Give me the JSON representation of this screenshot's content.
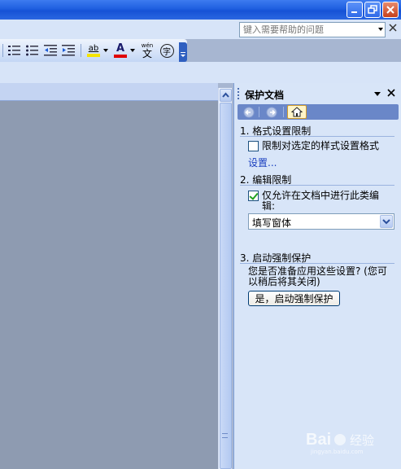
{
  "window": {
    "buttons": [
      "minimize",
      "restore",
      "close"
    ]
  },
  "help": {
    "placeholder": "键入需要帮助的问题"
  },
  "toolbar": {
    "icons": [
      "numbered-list-icon",
      "bulleted-list-icon",
      "decrease-indent-icon",
      "increase-indent-icon",
      "highlight-icon",
      "font-color-icon",
      "phonetic-guide-icon",
      "enclose-characters-icon"
    ],
    "highlight_label": "ab",
    "font_color_label": "A",
    "phonetic_label": "wén",
    "phonetic_char": "文",
    "enclose_char": "字",
    "highlight_color": "#f5e400",
    "font_color": "#e00000"
  },
  "pane": {
    "title": "保护文档",
    "section1": {
      "heading": "1. 格式设置限制",
      "checkbox_label": "限制对选定的样式设置格式",
      "checked": false,
      "link": "设置..."
    },
    "section2": {
      "heading": "2. 编辑限制",
      "checkbox_label_line1": "仅允许在文档中进行此类编",
      "checkbox_label_line2": "辑:",
      "checked": true,
      "select_value": "填写窗体"
    },
    "section3": {
      "heading": "3. 启动强制保护",
      "question_line1": "您是否准备应用这些设置? (您可",
      "question_line2": "以稍后将其关闭)",
      "button_label": "是，启动强制保护"
    }
  },
  "watermark": {
    "text": "Bai 经验",
    "sub": "jingyan.baidu.com"
  }
}
